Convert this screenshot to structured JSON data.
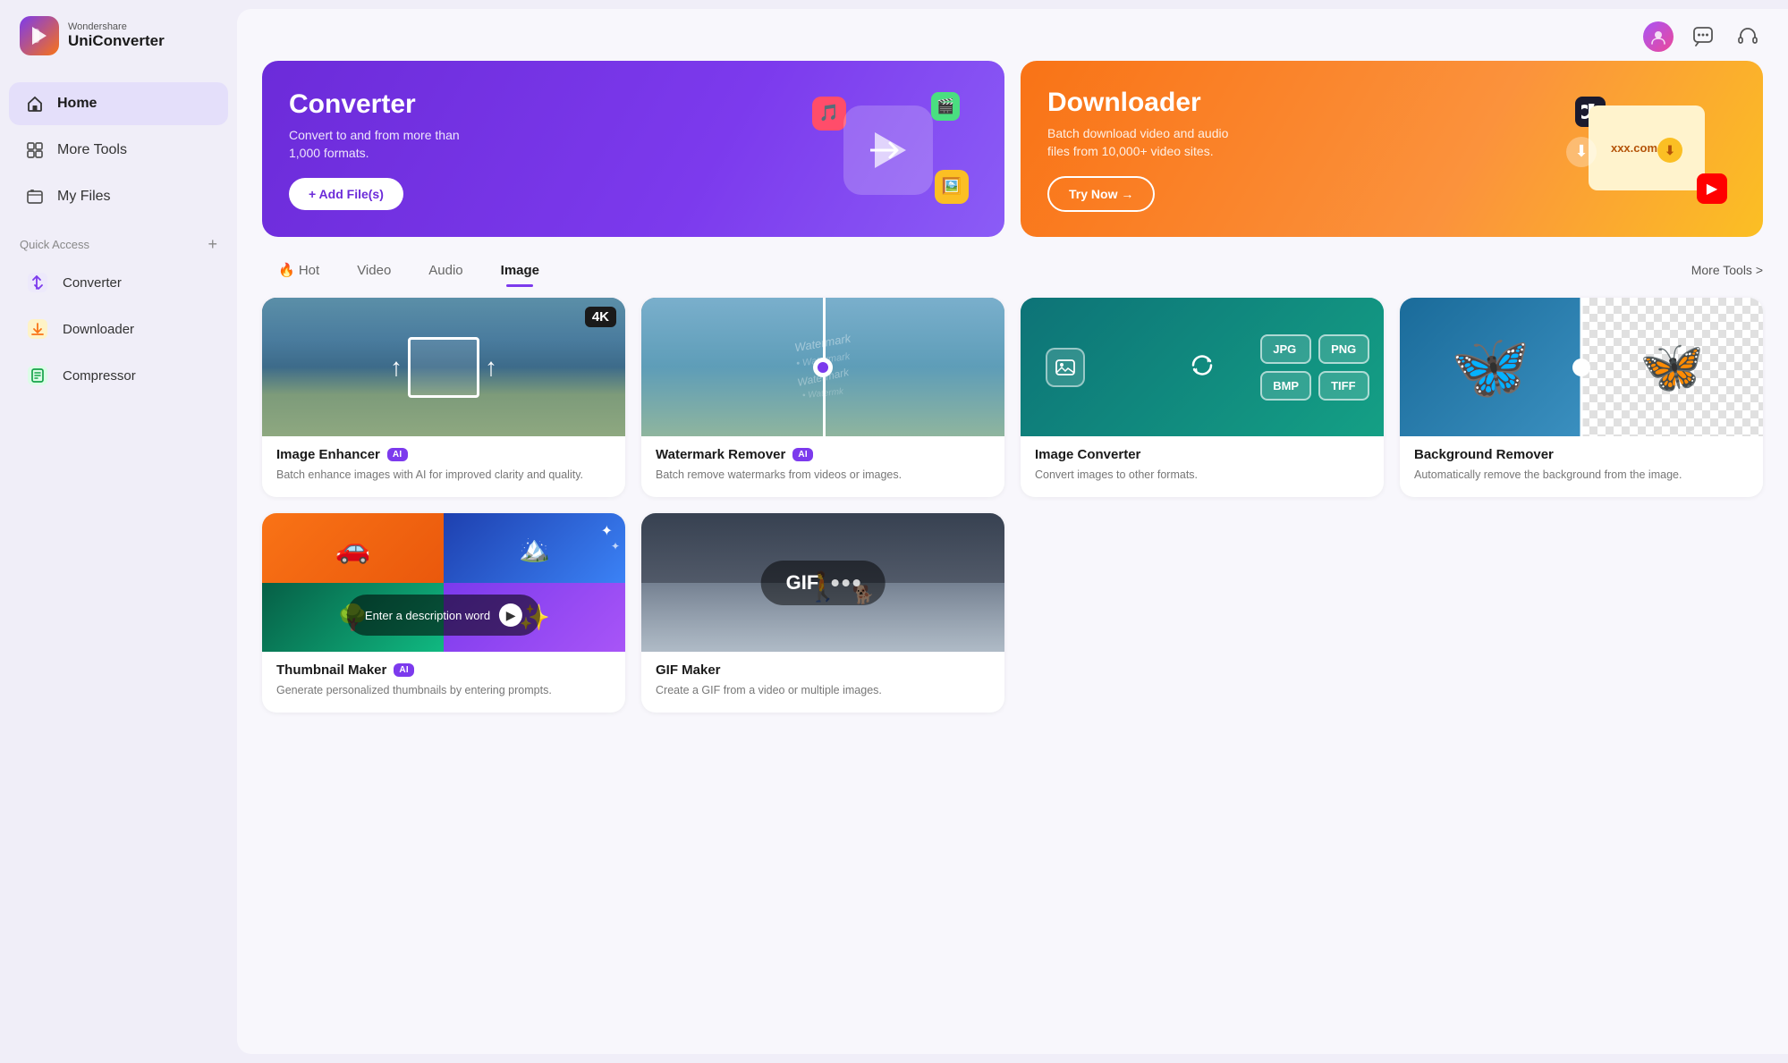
{
  "app": {
    "brand_top": "Wondershare",
    "brand_bottom": "UniConverter"
  },
  "traffic_lights": {
    "red": "close",
    "yellow": "minimize"
  },
  "sidebar": {
    "nav": [
      {
        "id": "home",
        "label": "Home",
        "active": true
      },
      {
        "id": "more-tools",
        "label": "More Tools",
        "active": false
      },
      {
        "id": "my-files",
        "label": "My Files",
        "active": false
      }
    ],
    "quick_access_label": "Quick Access",
    "quick_access_add_label": "+",
    "sub_items": [
      {
        "id": "converter",
        "label": "Converter"
      },
      {
        "id": "downloader",
        "label": "Downloader"
      },
      {
        "id": "compressor",
        "label": "Compressor"
      }
    ]
  },
  "banners": {
    "converter": {
      "title": "Converter",
      "description": "Convert to and from more than 1,000 formats.",
      "button_label": "+ Add File(s)"
    },
    "downloader": {
      "title": "Downloader",
      "description": "Batch download video and audio files from 10,000+ video sites.",
      "button_label": "Try Now →",
      "url_label": "xxx.com"
    }
  },
  "tabs": {
    "items": [
      {
        "id": "hot",
        "label": "🔥 Hot",
        "active": false
      },
      {
        "id": "video",
        "label": "Video",
        "active": false
      },
      {
        "id": "audio",
        "label": "Audio",
        "active": false
      },
      {
        "id": "image",
        "label": "Image",
        "active": true
      }
    ],
    "more_tools_label": "More Tools >"
  },
  "tools": [
    {
      "id": "image-enhancer",
      "title": "Image Enhancer",
      "ai": true,
      "description": "Batch enhance images with AI for improved clarity and quality.",
      "thumb_type": "enhancer"
    },
    {
      "id": "watermark-remover",
      "title": "Watermark Remover",
      "ai": true,
      "description": "Batch remove watermarks from videos or images.",
      "thumb_type": "watermark"
    },
    {
      "id": "image-converter",
      "title": "Image Converter",
      "ai": false,
      "description": "Convert images to other formats.",
      "thumb_type": "img-converter",
      "formats": [
        "JPG",
        "PNG",
        "BMP",
        "TIFF"
      ]
    },
    {
      "id": "background-remover",
      "title": "Background Remover",
      "ai": false,
      "description": "Automatically remove the background from the image.",
      "thumb_type": "bg-remover"
    },
    {
      "id": "thumbnail-maker",
      "title": "Thumbnail Maker",
      "ai": true,
      "description": "Generate personalized thumbnails by entering prompts.",
      "thumb_type": "thumbnail-maker",
      "input_placeholder": "Enter a description word"
    },
    {
      "id": "gif-maker",
      "title": "GIF Maker",
      "ai": false,
      "description": "Create a GIF from a video or multiple images.",
      "thumb_type": "gif-maker"
    }
  ],
  "ai_badge_label": "AI"
}
